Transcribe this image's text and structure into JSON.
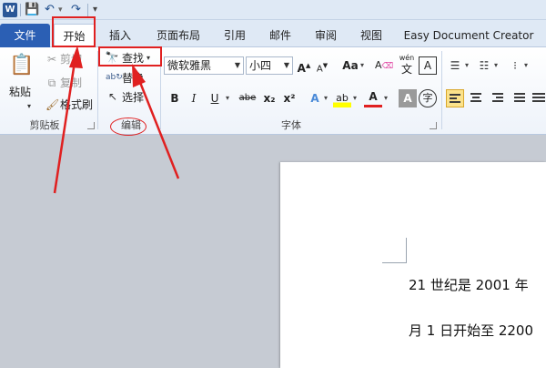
{
  "quick_access": {
    "word_logo": "W",
    "save_glyph": "💾",
    "undo_glyph": "↶",
    "redo_glyph": "↷",
    "customize_glyph": "▾"
  },
  "tabs": {
    "file": "文件",
    "home": "开始",
    "insert": "插入",
    "page_layout": "页面布局",
    "references": "引用",
    "mailings": "邮件",
    "review": "审阅",
    "view": "视图",
    "addin": "Easy Document Creator"
  },
  "clipboard": {
    "paste": "粘贴",
    "cut": "剪切",
    "copy": "复制",
    "format_painter": "格式刷",
    "group_label": "剪贴板"
  },
  "editing": {
    "find": "查找",
    "replace": "替换",
    "select": "选择",
    "group_label": "编辑"
  },
  "font": {
    "font_name": "微软雅黑",
    "font_size": "小四",
    "bold": "B",
    "italic": "I",
    "underline": "U",
    "strikethrough": "abe",
    "subscript": "x₂",
    "superscript": "x²",
    "grow": "A",
    "shrink": "A",
    "change_case": "Aa",
    "clear_format": "A",
    "phonetic": "wén",
    "char_border": "A",
    "text_effect": "A",
    "highlight": "ab",
    "font_color": "A",
    "char_shading": "A",
    "enclose": "字",
    "group_label": "字体"
  },
  "document": {
    "line1": "21 世纪是 2001 年",
    "line2": "月 1 日开始至 2200"
  },
  "colors": {
    "file_tab": "#2b5fb4",
    "highlight_red": "#e02020",
    "font_color_red": "#e02020",
    "highlight_yellow": "#ffff00",
    "selected_button": "#fbe28b"
  },
  "icons": {
    "paste": "clipboard-icon",
    "cut": "scissors-icon",
    "copy": "copy-icon",
    "format_painter": "paintbrush-icon",
    "find": "binoculars-icon",
    "replace": "replace-icon",
    "select": "cursor-icon"
  }
}
